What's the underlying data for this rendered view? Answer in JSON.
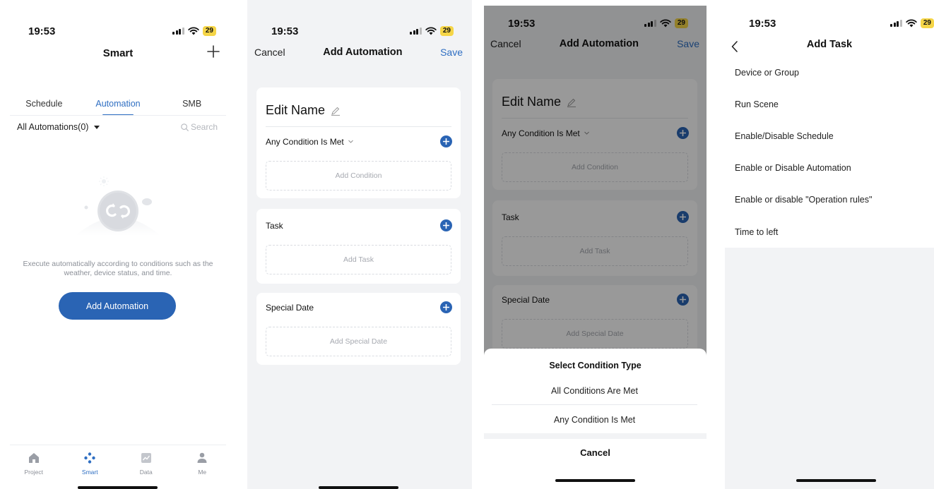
{
  "status_bar": {
    "time": "19:53",
    "battery": "29"
  },
  "smart": {
    "title": "Smart",
    "tabs": [
      "Schedule",
      "Automation",
      "SMB"
    ],
    "filter_label": "All Automations(0)",
    "search_placeholder": "Search",
    "empty_text": "Execute automatically according to conditions such as the weather, device status, and time.",
    "add_button": "Add Automation",
    "tabbar": [
      "Project",
      "Smart",
      "Data",
      "Me"
    ]
  },
  "add_automation": {
    "cancel": "Cancel",
    "title": "Add Automation",
    "save": "Save",
    "edit_name": "Edit Name",
    "condition_mode": "Any Condition Is Met",
    "add_condition": "Add Condition",
    "task_label": "Task",
    "add_task": "Add Task",
    "special_date_label": "Special Date",
    "add_special_date": "Add Special Date"
  },
  "condition_sheet": {
    "title": "Select Condition Type",
    "options": [
      "All Conditions Are Met",
      "Any Condition Is Met"
    ],
    "cancel": "Cancel"
  },
  "add_task": {
    "title": "Add Task",
    "items": [
      "Device or Group",
      "Run Scene",
      "Enable/Disable Schedule",
      "Enable or Disable Automation",
      "Enable or disable \"Operation rules\"",
      "Time to left"
    ]
  },
  "colors": {
    "accent": "#2e6ec2",
    "button": "#2a64b4",
    "battery": "#f5d547",
    "background": "#f2f3f5"
  }
}
